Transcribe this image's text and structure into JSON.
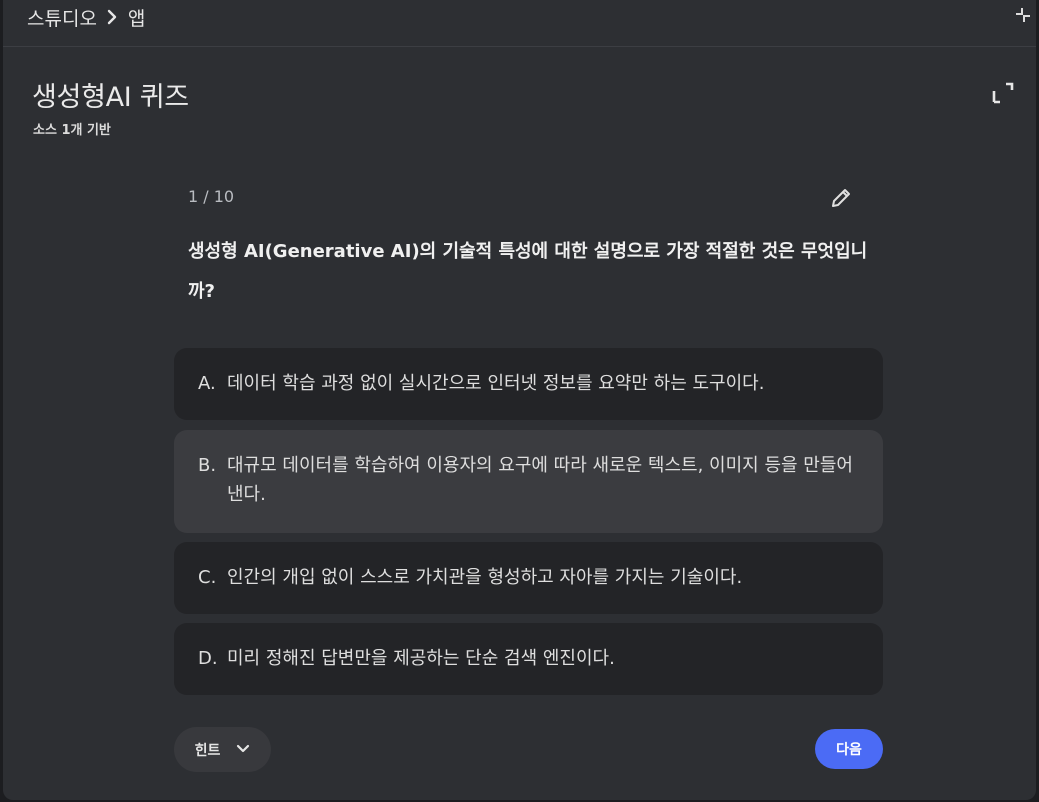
{
  "breadcrumb": {
    "root": "스튜디오",
    "current": "앱"
  },
  "quiz": {
    "title": "생성형AI 퀴즈",
    "subtitle": "소스 1개 기반",
    "counter": "1 / 10",
    "question": "생성형 AI(Generative AI)의 기술적 특성에 대한 설명으로 가장 적절한 것은 무엇입니까?",
    "options": [
      {
        "letter": "A.",
        "text": "데이터 학습 과정 없이 실시간으로 인터넷 정보를 요약만 하는 도구이다."
      },
      {
        "letter": "B.",
        "text": "대규모 데이터를 학습하여 이용자의 요구에 따라 새로운 텍스트, 이미지 등을 만들어낸다."
      },
      {
        "letter": "C.",
        "text": "인간의 개입 없이 스스로 가치관을 형성하고 자아를 가지는 기술이다."
      },
      {
        "letter": "D.",
        "text": "미리 정해진 답변만을 제공하는 단순 검색 엔진이다."
      }
    ],
    "hint_label": "힌트",
    "next_label": "다음"
  },
  "icons": {
    "chevron": "chevron-right-icon",
    "collapse": "collapse-icon",
    "expand": "fullscreen-expand-icon",
    "edit": "pencil-icon",
    "dropdown": "chevron-down-icon"
  },
  "colors": {
    "background": "#2d2f33",
    "option_background": "#232427",
    "option_hover": "#3b3c40",
    "accent": "#4b6bf5"
  }
}
